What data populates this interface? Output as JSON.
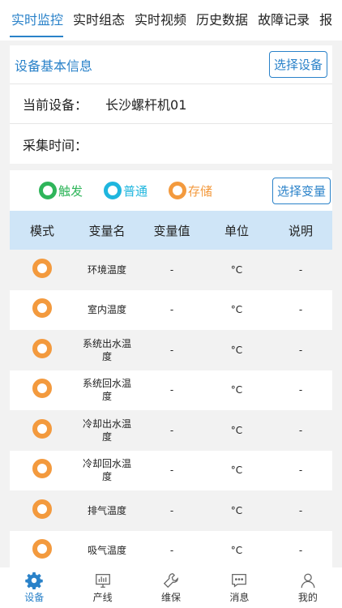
{
  "tabs": [
    "实时监控",
    "实时组态",
    "实时视频",
    "历史数据",
    "故障记录",
    "报"
  ],
  "info": {
    "title": "设备基本信息",
    "select_button": "选择设备",
    "device_label": "当前设备：",
    "device_value": "长沙螺杆机01",
    "time_label": "采集时间："
  },
  "legend": {
    "items": [
      {
        "label": "触发",
        "color": "#2fb55a"
      },
      {
        "label": "普通",
        "color": "#1fb6de"
      },
      {
        "label": "存储",
        "color": "#f39a3e"
      }
    ],
    "select_button": "选择变量"
  },
  "table": {
    "headers": [
      "模式",
      "变量名",
      "变量值",
      "单位",
      "说明"
    ],
    "rows": [
      {
        "name": "环境温度",
        "value": "-",
        "unit": "°C",
        "note": "-"
      },
      {
        "name": "室内温度",
        "value": "-",
        "unit": "°C",
        "note": "-"
      },
      {
        "name": "系统出水温度",
        "value": "-",
        "unit": "°C",
        "note": "-"
      },
      {
        "name": "系统回水温度",
        "value": "-",
        "unit": "°C",
        "note": "-"
      },
      {
        "name": "冷却出水温度",
        "value": "-",
        "unit": "°C",
        "note": "-"
      },
      {
        "name": "冷却回水温度",
        "value": "-",
        "unit": "°C",
        "note": "-"
      },
      {
        "name": "排气温度",
        "value": "-",
        "unit": "°C",
        "note": "-"
      },
      {
        "name": "吸气温度",
        "value": "-",
        "unit": "°C",
        "note": "-"
      }
    ]
  },
  "bottom_nav": {
    "device": "设备",
    "line": "产线",
    "maintenance": "维保",
    "message": "消息",
    "mine": "我的"
  },
  "colors": {
    "accent": "#2a82c9",
    "mode_ring": "#f39a3e",
    "header_bg": "#cfe5f7"
  }
}
